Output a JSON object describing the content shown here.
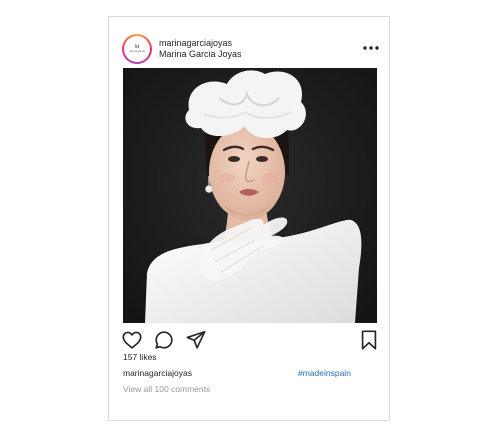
{
  "post": {
    "username": "marinagarciajoyas",
    "full_name": "Marina Garcia Joyas",
    "avatar": {
      "mark": "M",
      "text": "marina garcia",
      "ring_colors": [
        "#f9a23c",
        "#e8316b",
        "#a83fc4"
      ]
    },
    "more_icon": "more-dots-icon",
    "image": {
      "subject": "woman-portrait-photo",
      "background_color": "#1c1c1c"
    },
    "actions": {
      "icons": [
        "heart-icon",
        "comment-icon",
        "share-icon",
        "bookmark-icon"
      ]
    },
    "likes": "157 likes",
    "caption": {
      "username": "marinagarciajoyas",
      "hashtag": "#madeinspain"
    },
    "view_comments": "View all 100 comments",
    "colors": {
      "hashtag": "#1f6fb2",
      "muted_text": "#9a9a9a",
      "border": "#d9d9d9"
    }
  }
}
